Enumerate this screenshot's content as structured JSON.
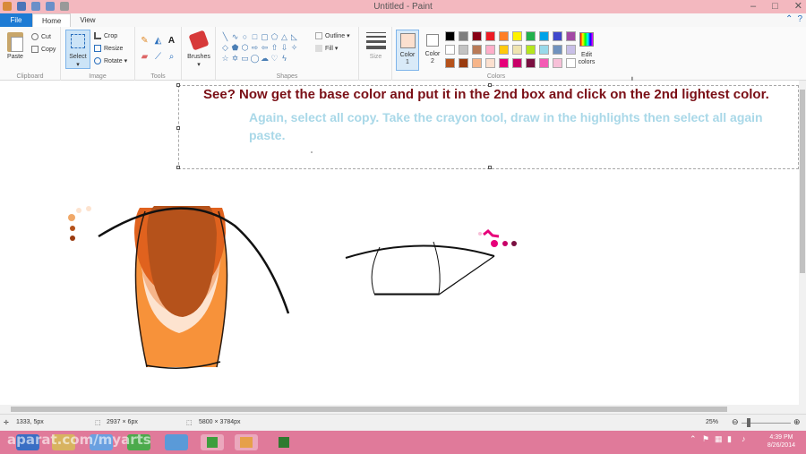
{
  "window": {
    "title": "Untitled - Paint",
    "minimize": "–",
    "maximize": "□",
    "close": "✕"
  },
  "tabs": [
    {
      "label": "File"
    },
    {
      "label": "Home"
    },
    {
      "label": "View"
    }
  ],
  "ribbon": {
    "clipboard": {
      "paste": "Paste",
      "cut": "Cut",
      "copy": "Copy",
      "label": "Clipboard"
    },
    "image": {
      "select": "Select",
      "crop": "Crop",
      "resize": "Resize",
      "rotate": "Rotate",
      "label": "Image"
    },
    "tools": {
      "label": "Tools",
      "icons": [
        "pencil-icon",
        "fill-icon",
        "text-icon",
        "eraser-icon",
        "color-picker-icon",
        "magnifier-icon"
      ]
    },
    "brushes": {
      "label": "Brushes"
    },
    "shapes": {
      "label": "Shapes",
      "outline": "Outline",
      "fill": "Fill"
    },
    "size": {
      "label": "Size"
    },
    "colors": {
      "color1_label": "Color\n1",
      "color2_label": "Color\n2",
      "edit_label": "Edit\ncolors",
      "label": "Colors",
      "color1": "#fce0cf",
      "color2": "#ffffff",
      "palette": [
        "#000000",
        "#7f7f7f",
        "#880015",
        "#ed1c24",
        "#ff7f27",
        "#fff200",
        "#22b14c",
        "#00a2e8",
        "#3f48cc",
        "#a349a4",
        "#ffffff",
        "#c3c3c3",
        "#b97a57",
        "#ffaec9",
        "#ffc90e",
        "#efe4b0",
        "#b5e61d",
        "#99d9ea",
        "#7092be",
        "#c8bfe7",
        "#b5521b",
        "#9a3b10",
        "#f6b58a",
        "#fce0cf",
        "#e7007a",
        "#c80068",
        "#7a1040",
        "#f45ab4",
        "#f7c0d8",
        "#ffffff"
      ]
    }
  },
  "canvas": {
    "text_line1": "See? Now get the base color and put it in the 2nd box and click on the 2nd lightest color.",
    "text_line2": "Again, select all copy. Take the crayon tool, draw in the highlights then select all again paste.",
    "text1_color": "#7a0f16",
    "text2_color": "#a9d8e8"
  },
  "status": {
    "cursor_pos": "1333, 5px",
    "selection_size": "2937 × 6px",
    "image_size": "5800 × 3784px",
    "zoom": "25%"
  },
  "taskbar": {
    "watermark": "aparat.com/myarts",
    "time": "4:39 PM",
    "date": "8/26/2014"
  }
}
